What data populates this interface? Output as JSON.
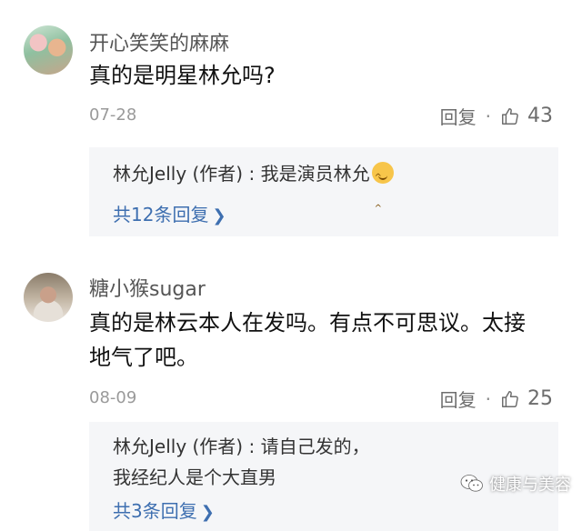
{
  "comments": [
    {
      "nickname": "开心笑笑的麻麻",
      "text": "真的是明星林允吗?",
      "date": "07-28",
      "reply_label": "回复",
      "separator": "·",
      "likes": "43",
      "author_reply": "林允Jelly (作者) : 我是演员林允",
      "view_replies": "共12条回复"
    },
    {
      "nickname": "糖小猴sugar",
      "text": "真的是林云本人在发吗。有点不可思议。太接地气了吧。",
      "date": "08-09",
      "reply_label": "回复",
      "separator": "·",
      "likes": "25",
      "author_reply": "林允Jelly (作者) : 请自己发的，我经纪人是个大直男",
      "view_replies": "共3条回复"
    }
  ],
  "watermark": "健康与美容",
  "colors": {
    "link": "#3e6fb0",
    "reply_bg": "#f5f6f8",
    "meta": "#9a9a9a"
  }
}
